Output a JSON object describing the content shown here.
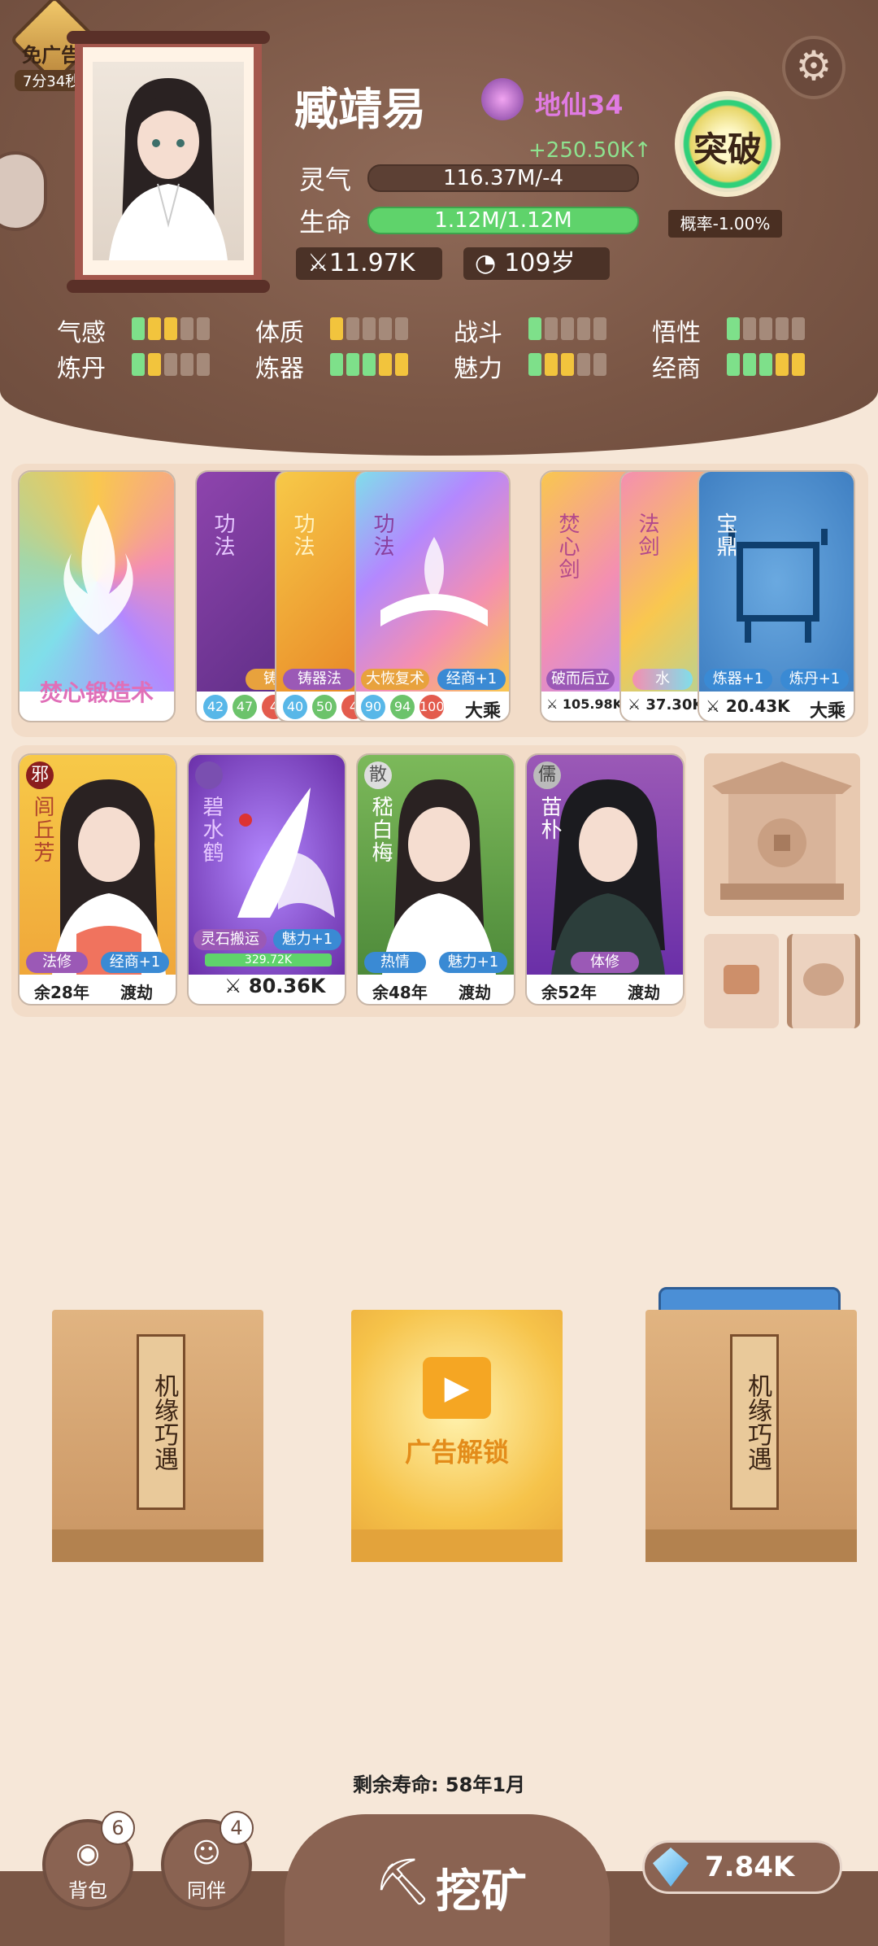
{
  "header": {
    "noad_label": "免广告",
    "noad_timer": "7分34秒",
    "player_name": "臧靖易",
    "realm": "地仙34",
    "lingqi_label": "灵气",
    "lingqi_value": "116.37M/-4",
    "lingqi_gain": "+250.50K↑",
    "life_label": "生命",
    "life_value": "1.12M/1.12M",
    "life_fraction": 1.0,
    "power": "11.97K",
    "age": "109岁",
    "breakthrough_label": "突破",
    "breakthrough_prob": "概率-1.00%"
  },
  "attributes": [
    {
      "label": "气感",
      "levels": [
        "g",
        "y",
        "y",
        "n",
        "n"
      ]
    },
    {
      "label": "体质",
      "levels": [
        "y",
        "n",
        "n",
        "n",
        "n"
      ]
    },
    {
      "label": "战斗",
      "levels": [
        "g",
        "n",
        "n",
        "n",
        "n"
      ]
    },
    {
      "label": "悟性",
      "levels": [
        "g",
        "n",
        "n",
        "n",
        "n"
      ]
    },
    {
      "label": "炼丹",
      "levels": [
        "g",
        "y",
        "n",
        "n",
        "n"
      ]
    },
    {
      "label": "炼器",
      "levels": [
        "g",
        "g",
        "g",
        "y",
        "y"
      ]
    },
    {
      "label": "魅力",
      "levels": [
        "g",
        "y",
        "y",
        "n",
        "n"
      ]
    },
    {
      "label": "经商",
      "levels": [
        "g",
        "g",
        "g",
        "y",
        "y"
      ]
    }
  ],
  "cards_row1": {
    "art_card": {
      "title": "焚心锻造术"
    },
    "gongfa": [
      {
        "type": "功法",
        "tag": "铸器",
        "nums": [
          "42",
          "47",
          "4"
        ]
      },
      {
        "type": "功法",
        "tag": "铸器法",
        "nums": [
          "40",
          "50",
          "4"
        ]
      },
      {
        "type": "功法",
        "tag1": "大恢复术",
        "tag2": "经商+1",
        "nums": [
          "90",
          "94",
          "100"
        ],
        "level": "大乘"
      }
    ],
    "weapons": [
      {
        "name": "焚心剑",
        "tag": "破而后立",
        "power": "105.98K"
      },
      {
        "name": "法剑",
        "tag": "水",
        "power": "37.30K"
      },
      {
        "name": "宝鼎",
        "tag1": "炼器+1",
        "tag2": "炼丹+1",
        "power": "20.43K",
        "level": "大乘"
      }
    ]
  },
  "companions": [
    {
      "badge": "邪",
      "name": "闾丘芳",
      "tag1": "法修",
      "tag2": "经商+1",
      "life": "余28年",
      "state": "渡劫"
    },
    {
      "badge": "",
      "name": "碧水鹤",
      "tag1": "灵石搬运",
      "tag2": "魅力+1",
      "bar": "329.72K",
      "power": "80.36K"
    },
    {
      "badge": "散",
      "name": "嵇白梅",
      "tag1": "热情",
      "tag2": "魅力+1",
      "life": "余48年",
      "state": "渡劫"
    },
    {
      "badge": "儒",
      "name": "苗朴",
      "tag1": "体修",
      "life": "余52年",
      "state": "渡劫"
    }
  ],
  "packs": [
    {
      "label": "机缘巧遇"
    },
    {
      "label": "广告解锁"
    },
    {
      "label": "机缘巧遇"
    }
  ],
  "footer": {
    "remaining_life": "剩余寿命: 58年1月",
    "bag_label": "背包",
    "bag_count": "6",
    "partner_label": "同伴",
    "partner_count": "4",
    "mine_label": "挖矿",
    "diamonds": "7.84K"
  },
  "colors": {
    "header_brown": "#7a5645",
    "life_green": "#5fd36b",
    "realm_pink": "#e07be2"
  }
}
